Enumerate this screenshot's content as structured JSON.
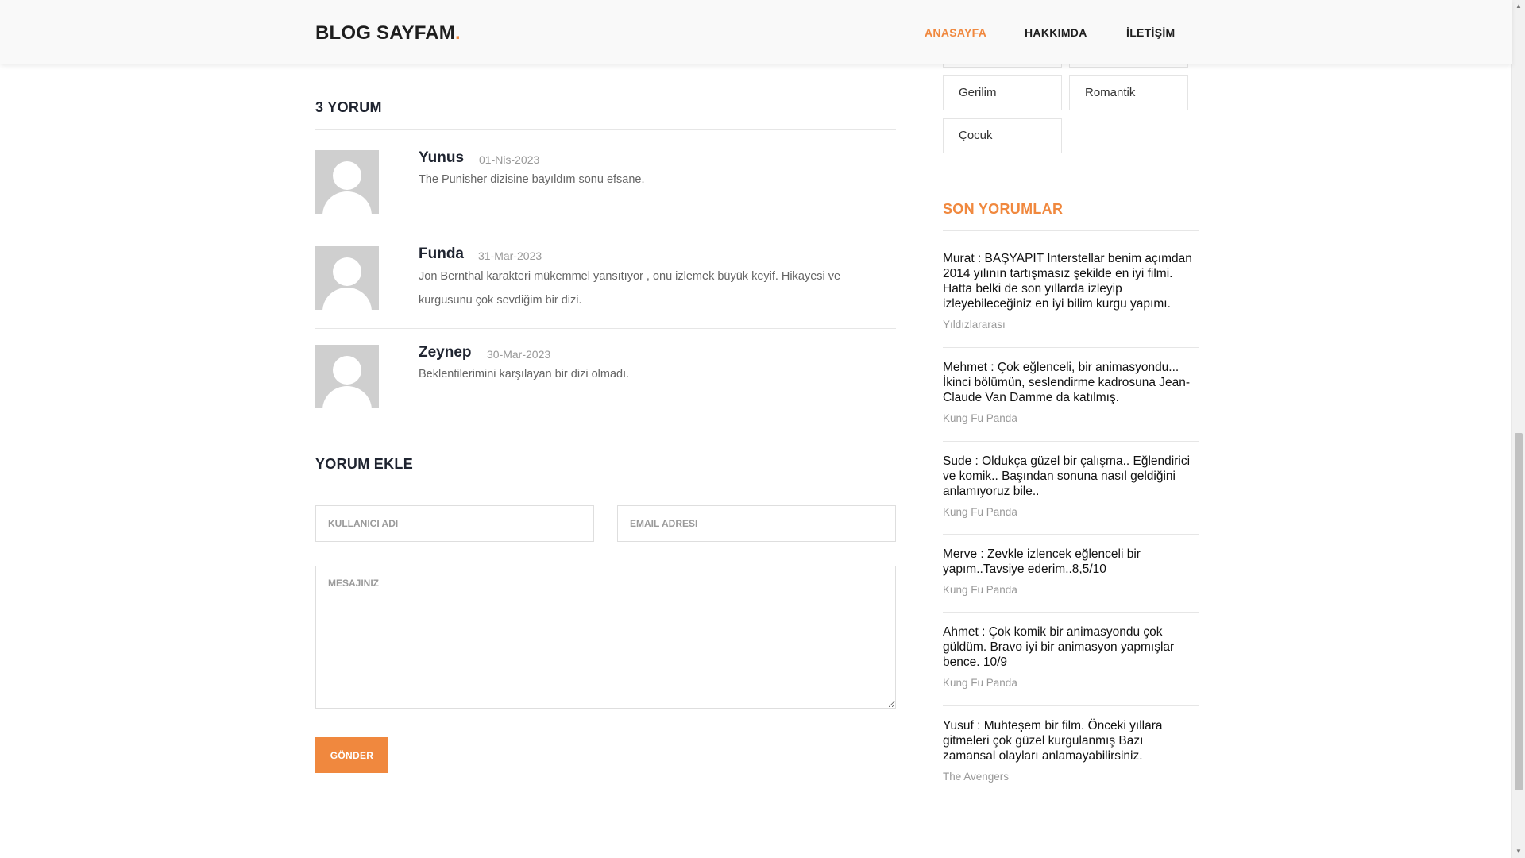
{
  "header": {
    "logo": "BLOG SAYFAM",
    "logo_dot": ".",
    "nav": [
      "ANASAYFA",
      "HAKKIMDA",
      "İLETİŞİM"
    ]
  },
  "comments": {
    "title": "3 YORUM",
    "items": [
      {
        "name": "Yunus",
        "date": "01-Nis-2023",
        "text": "The Punisher dizisine bayıldım sonu efsane."
      },
      {
        "name": "Funda",
        "date": "31-Mar-2023",
        "text_line1": "Jon Bernthal karakteri mükemmel yansıtıyor , onu izlemek büyük keyif. Hikayesi ve",
        "text_line2": "kurgusunu çok sevdiğim bir dizi."
      },
      {
        "name": "Zeynep",
        "date": "30-Mar-2023",
        "text": "Beklentilerimini karşılayan bir dizi olmadı."
      }
    ]
  },
  "form": {
    "title": "YORUM EKLE",
    "username_placeholder": "KULLANICI ADI",
    "email_placeholder": "EMAIL ADRESI",
    "message_placeholder": "MESAJINIZ",
    "submit_label": "GÖNDER"
  },
  "sidebar": {
    "tags": [
      "Gerilim",
      "Romantik",
      "Çocuk"
    ],
    "recent_title": "SON YORUMLAR",
    "recent": [
      {
        "text": "Murat : BAŞYAPIT Interstellar benim açımdan 2014 yılının tartışmasız şekilde en iyi filmi. Hatta belki de son yıllarda izleyip izleyebileceğiniz en iyi bilim kurgu yapımı.",
        "source": "Yıldızlararası"
      },
      {
        "text": "Mehmet : Çok eğlenceli, bir animasyondu... İkinci bölümün, seslendirme kadrosuna Jean-Claude Van Damme da katılmış.",
        "source": "Kung Fu Panda"
      },
      {
        "text": "Sude : Oldukça güzel bir çalışma.. Eğlendirici ve komik.. Başından sonuna nasıl geldiğini anlamıyoruz bile..",
        "source": "Kung Fu Panda"
      },
      {
        "text": "Merve : Zevkle izlencek eğlenceli bir yapım..Tavsiye ederim..8,5/10",
        "source": "Kung Fu Panda"
      },
      {
        "text": "Ahmet : Çok komik bir animasyondu çok güldüm. Bravo iyi bir animasyon yapmışlar bence. 10/9",
        "source": "Kung Fu Panda"
      },
      {
        "text": "Yusuf : Muhteşem bir film. Önceki yıllara gitmeleri çok güzel kurgulanmış Bazı zamansal olayları anlamayabilirsiniz.",
        "source": "The Avengers"
      }
    ]
  },
  "colors": {
    "accent": "#f0883e",
    "text_dark": "#1f2430",
    "muted": "#999999"
  }
}
